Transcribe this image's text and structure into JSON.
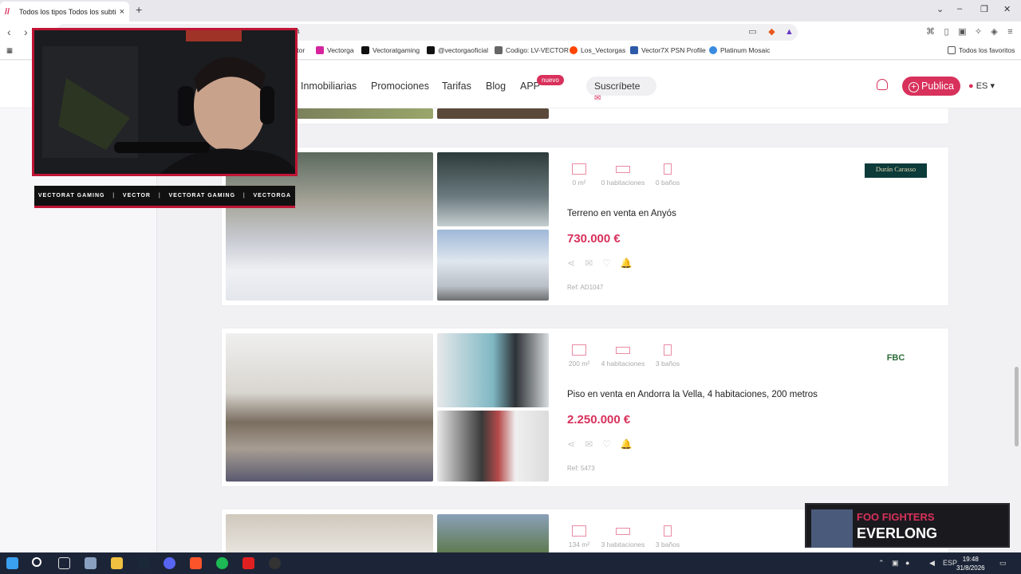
{
  "browser": {
    "tab_title": "Todos los tipos Todos los subtipos",
    "tab_close": "×",
    "new_tab": "+",
    "url_fragment": "a",
    "bookmarks": [
      {
        "label": "ctor",
        "icon": "bookmark-icon"
      },
      {
        "label": "Vectorga",
        "icon": "instagram-icon"
      },
      {
        "label": "Vectoratgaming",
        "icon": "x-icon"
      },
      {
        "label": "@vectorgaoficial",
        "icon": "tiktok-icon"
      },
      {
        "label": "Codigo: LV-VECTOR",
        "icon": "bookmark-icon"
      },
      {
        "label": "Los_Vectorgas",
        "icon": "reddit-icon"
      },
      {
        "label": "Vector7X PSN Profile",
        "icon": "psn-icon"
      },
      {
        "label": "Platinum Mosaic",
        "icon": "globe-icon"
      }
    ],
    "favorites_label": "Todos los favoritos"
  },
  "site": {
    "nav": [
      "Inmobiliarias",
      "Promociones",
      "Tarifas",
      "Blog",
      "APP"
    ],
    "nuevo_badge": "nuevo",
    "subscribe": "Suscríbete",
    "publish": "Publica",
    "lang": "ES"
  },
  "listings": [
    {
      "area": "0 m²",
      "rooms": "0 habitaciones",
      "baths": "0 baños",
      "title": "Terreno en venta en Anyós",
      "price": "730.000 €",
      "ref": "Ref: AD1047",
      "agency": "Durán Carasso"
    },
    {
      "area": "200 m²",
      "rooms": "4 habitaciones",
      "baths": "3 baños",
      "title": "Piso en venta en Andorra la Vella, 4 habitaciones, 200 metros",
      "price": "2.250.000 €",
      "ref": "Ref: 5473",
      "agency": "FBC"
    },
    {
      "area": "134 m²",
      "rooms": "3 habitaciones",
      "baths": "3 baños"
    }
  ],
  "overlay": {
    "socials": [
      "VECTORAT GAMING",
      "VECTOR",
      "VECTORAT GAMING",
      "VECTORGA"
    ],
    "now_playing_artist": "FOO FIGHTERS",
    "now_playing_song": "EVERLONG"
  },
  "taskbar": {
    "lang": "ESP",
    "time": "19:48",
    "date": "31/8/2026"
  },
  "colors": {
    "accent": "#d8315b",
    "stream_red": "#c01535"
  }
}
